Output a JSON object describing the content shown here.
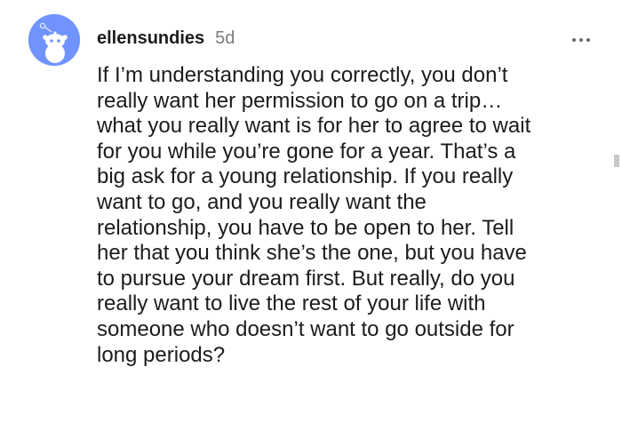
{
  "comment": {
    "author": "ellensundies",
    "age": "5d",
    "body": "If I’m understanding you correctly, you don’t\nreally want her permission to go on a trip…\nwhat you really want is for her to agree to wait\nfor you while you’re gone for a year. That’s a\nbig ask for a young relationship. If you really\nwant to go, and you really want the\nrelationship, you have to be open to her. Tell\nher that you think she’s the one, but you have\nto pursue your dream first. But really, do you\nreally want to live the rest of your life with\nsomeone who doesn’t want to go outside for\nlong periods?",
    "avatar_icon": "snoo-avatar-icon",
    "more_icon": "more-options-icon"
  },
  "colors": {
    "avatar_bg": "#7193ff",
    "text": "#1c1c1c",
    "meta": "#7c7c7c"
  }
}
